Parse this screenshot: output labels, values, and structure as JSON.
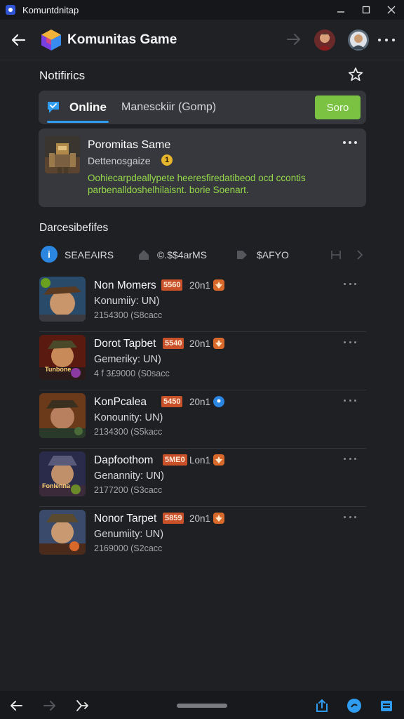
{
  "window": {
    "title": "Komuntdnitap",
    "minimize_icon": "minimize-icon",
    "maximize_icon": "maximize-icon",
    "close_icon": "close-icon"
  },
  "header": {
    "back_icon": "arrow-left-icon",
    "logo_icon": "cube-logo-icon",
    "title": "Komunitas Game",
    "forward_icon": "arrow-right-icon",
    "avatars": [
      "avatar-user-1",
      "avatar-user-2"
    ],
    "more_icon": "more-horizontal-icon"
  },
  "notifications": {
    "title": "Notifirics",
    "star_icon": "star-outline-icon"
  },
  "tabs": {
    "active_label": "Online",
    "secondary_label": "Manesckiir (Gomp)",
    "action_label": "Soro"
  },
  "featured": {
    "title": "Poromitas Same",
    "subtitle": "Dettenosgaize",
    "coin_label": "1",
    "description": "Oohiecarpdeallypete heeresfiredatibeod ocd ccontis parbenalldoshelhilaisnt. borie Soenart."
  },
  "section2": {
    "title": "Darcesibefifes",
    "filters": [
      {
        "label": "SEAEAIRS"
      },
      {
        "label": "©.$$4arMS"
      },
      {
        "label": "$AFYO"
      }
    ]
  },
  "games": [
    {
      "name": "Non Momers",
      "badge": "5560",
      "meta": "20n1",
      "sub": "Konumiiy: UN)",
      "stat": "2154300 (S8cacc"
    },
    {
      "name": "Dorot Tapbet",
      "badge": "5540",
      "meta": "20n1",
      "sub": "Gemeriky: UN)",
      "stat": "4 f 3£9000 (S0sacc"
    },
    {
      "name": "KonPcalea",
      "badge": "5450",
      "meta": "20n1",
      "sub": "Konounity: UN)",
      "stat": "2134300 (S5kacc"
    },
    {
      "name": "Dapfoothom",
      "badge": "5ME0",
      "meta": "Lon1",
      "sub": "Genannity: UN)",
      "stat": "2177200 (S3cacc"
    },
    {
      "name": "Nonor Tarpet",
      "badge": "5859",
      "meta": "20n1",
      "sub": "Genumiity: UN)",
      "stat": "2169000 (S2cacc"
    }
  ],
  "game_icon_labels": [
    "",
    "Tunbone",
    "",
    "Fonlenna",
    ""
  ],
  "colors": {
    "accent_blue": "#2f9cf0",
    "action_green": "#7bc243",
    "description_green": "#95d94a",
    "badge_orange": "#c9512a",
    "background": "#1f2024",
    "card": "#37383d"
  }
}
